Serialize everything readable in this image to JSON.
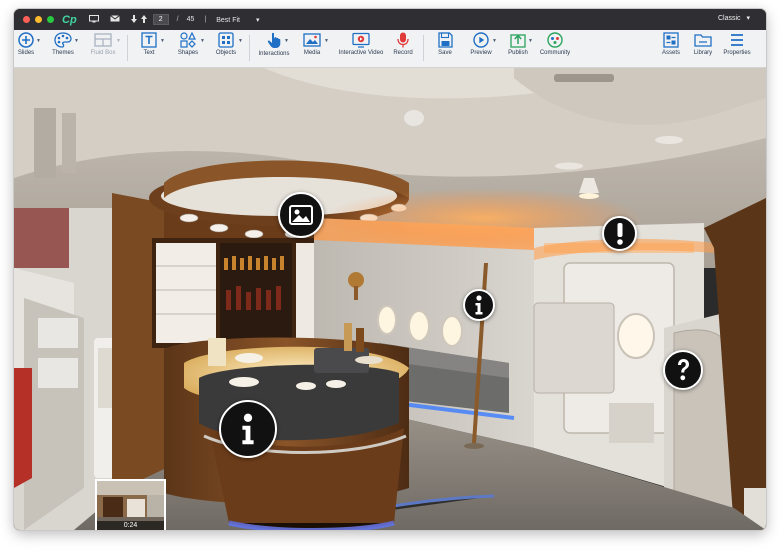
{
  "titlebar": {
    "app_logo": "Cp",
    "current_slide": "2",
    "slide_divider": "/",
    "total_slides": "45",
    "fit_mode": "Best Fit",
    "workspace": "Classic"
  },
  "toolbar": {
    "items": [
      {
        "label": "Slides",
        "icon": "plus-circle-icon"
      },
      {
        "label": "Themes",
        "icon": "palette-icon"
      },
      {
        "label": "Fluid Box",
        "icon": "fluid-box-icon",
        "disabled": true
      },
      {
        "label": "Text",
        "icon": "text-icon"
      },
      {
        "label": "Shapes",
        "icon": "shapes-icon"
      },
      {
        "label": "Objects",
        "icon": "objects-icon"
      },
      {
        "label": "Interactions",
        "icon": "hand-pointer-icon"
      },
      {
        "label": "Media",
        "icon": "image-icon"
      },
      {
        "label": "Interactive Video",
        "icon": "video-icon"
      },
      {
        "label": "Record",
        "icon": "microphone-icon"
      },
      {
        "label": "Save",
        "icon": "floppy-disk-icon"
      },
      {
        "label": "Preview",
        "icon": "play-circle-icon"
      },
      {
        "label": "Publish",
        "icon": "publish-icon"
      },
      {
        "label": "Community",
        "icon": "community-icon"
      },
      {
        "label": "Assets",
        "icon": "assets-icon"
      },
      {
        "label": "Library",
        "icon": "library-icon"
      },
      {
        "label": "Properties",
        "icon": "menu-lines-icon"
      }
    ]
  },
  "stage": {
    "hotspots": [
      {
        "type": "image",
        "icon": "image-icon"
      },
      {
        "type": "alert",
        "icon": "exclamation-icon"
      },
      {
        "type": "info",
        "icon": "info-icon"
      },
      {
        "type": "info",
        "icon": "info-icon"
      },
      {
        "type": "question",
        "icon": "question-icon"
      }
    ],
    "thumbnail_time": "0:24"
  },
  "colors": {
    "titlebar_bg": "#2f2f33",
    "toolbar_bg": "#f1f2f4",
    "toolbar_icon": "#1f6fc5",
    "record_red": "#e03a3a",
    "community_green": "#2aa35f",
    "hotspot_fill": "#111111"
  }
}
